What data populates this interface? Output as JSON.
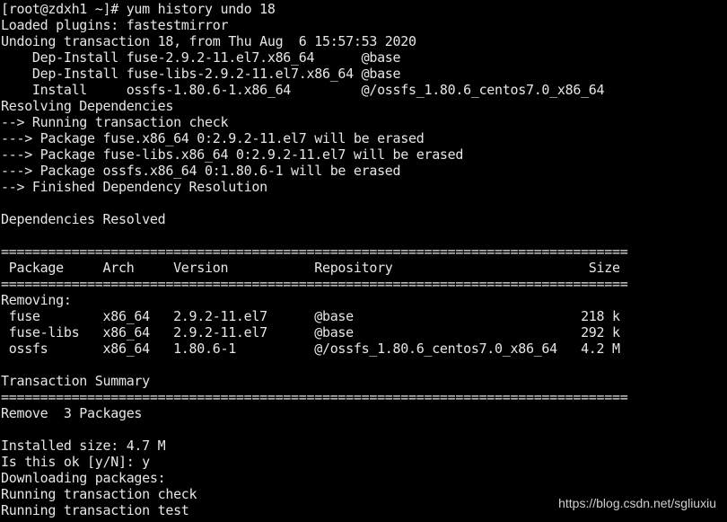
{
  "terminal": {
    "lines": [
      "[root@zdxh1 ~]# yum history undo 18",
      "Loaded plugins: fastestmirror",
      "Undoing transaction 18, from Thu Aug  6 15:57:53 2020",
      "    Dep-Install fuse-2.9.2-11.el7.x86_64      @base",
      "    Dep-Install fuse-libs-2.9.2-11.el7.x86_64 @base",
      "    Install     ossfs-1.80.6-1.x86_64         @/ossfs_1.80.6_centos7.0_x86_64",
      "Resolving Dependencies",
      "--> Running transaction check",
      "---> Package fuse.x86_64 0:2.9.2-11.el7 will be erased",
      "---> Package fuse-libs.x86_64 0:2.9.2-11.el7 will be erased",
      "---> Package ossfs.x86_64 0:1.80.6-1 will be erased",
      "--> Finished Dependency Resolution",
      "",
      "Dependencies Resolved",
      "",
      "================================================================================",
      " Package     Arch     Version           Repository                         Size",
      "================================================================================",
      "Removing:",
      " fuse        x86_64   2.9.2-11.el7      @base                             218 k",
      " fuse-libs   x86_64   2.9.2-11.el7      @base                             292 k",
      " ossfs       x86_64   1.80.6-1          @/ossfs_1.80.6_centos7.0_x86_64   4.2 M",
      "",
      "Transaction Summary",
      "================================================================================",
      "Remove  3 Packages",
      "",
      "Installed size: 4.7 M",
      "Is this ok [y/N]: y",
      "Downloading packages:",
      "Running transaction check",
      "Running transaction test"
    ]
  },
  "watermark": "https://blog.csdn.net/sgliuxiu",
  "colors": {
    "background": "#000000",
    "foreground": "#e6e6e6"
  }
}
